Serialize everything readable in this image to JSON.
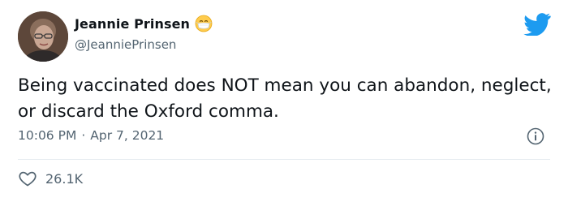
{
  "author": {
    "name": "Jeannie Prinsen",
    "handle": "@JeanniePrinsen"
  },
  "tweet": {
    "text": "Being vaccinated does NOT mean you can abandon, neglect, or discard the Oxford comma.",
    "time": "10:06 PM",
    "separator": "·",
    "date": "Apr 7, 2021",
    "likes": "26.1K"
  },
  "icons": {
    "avatar": "profile-photo",
    "name_emoji": "face-with-medical-mask-icon",
    "brand": "twitter-bird-icon",
    "info": "info-icon",
    "like": "heart-icon"
  },
  "colors": {
    "text": "#0f1419",
    "secondary": "#536471",
    "twitter_blue": "#1d9bf0",
    "divider": "#e6ecf0"
  }
}
